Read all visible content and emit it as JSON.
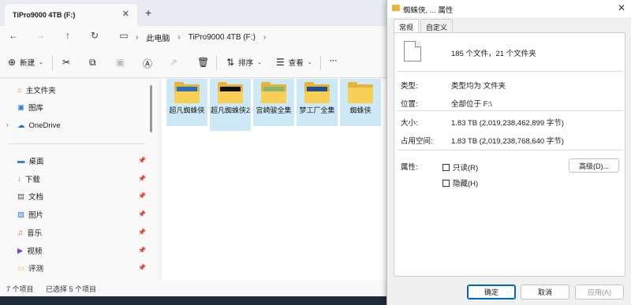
{
  "explorer": {
    "tab_title": "TiPro9000 4TB (F:)",
    "tab_close": "✕",
    "tab_add": "+",
    "breadcrumbs": [
      "此电脑",
      "TiPro9000 4TB (F:)"
    ],
    "toolbar": {
      "new_label": "新建",
      "sort_label": "排序",
      "view_label": "查看",
      "more_label": "···"
    },
    "sidebar": {
      "home": "主文件夹",
      "gallery": "图库",
      "onedrive": "OneDrive",
      "quick": [
        "桌面",
        "下载",
        "文档",
        "图片",
        "音乐",
        "视频",
        "评测"
      ]
    },
    "files": [
      {
        "label": "超凡蜘蛛侠",
        "selected": true
      },
      {
        "label": "超凡蜘蛛侠2",
        "selected": true
      },
      {
        "label": "宫崎骏全集",
        "selected": true
      },
      {
        "label": "梦工厂全集",
        "selected": true
      },
      {
        "label": "蜘蛛侠",
        "selected": true
      }
    ],
    "status": {
      "count": "7 个项目",
      "selected": "已选择 5 个项目"
    }
  },
  "dialog": {
    "title": "蜘蛛侠, ... 属性",
    "close": "✕",
    "tabs": [
      "常规",
      "自定义"
    ],
    "summary": "185 个文件，21 个文件夹",
    "properties": {
      "type_label": "类型:",
      "type_value": "类型均为 文件夹",
      "location_label": "位置:",
      "location_value": "全部位于 F:\\",
      "size_label": "大小:",
      "size_value": "1.83 TB (2,019,238,462,899 字节)",
      "disk_label": "占用空间:",
      "disk_value": "1.83 TB (2,019,238,768,640 字节)",
      "attr_label": "属性:",
      "readonly": "只读(R)",
      "hidden": "隐藏(H)",
      "advanced": "高级(D)..."
    },
    "buttons": {
      "ok": "确定",
      "cancel": "取消",
      "apply": "应用(A)"
    }
  }
}
